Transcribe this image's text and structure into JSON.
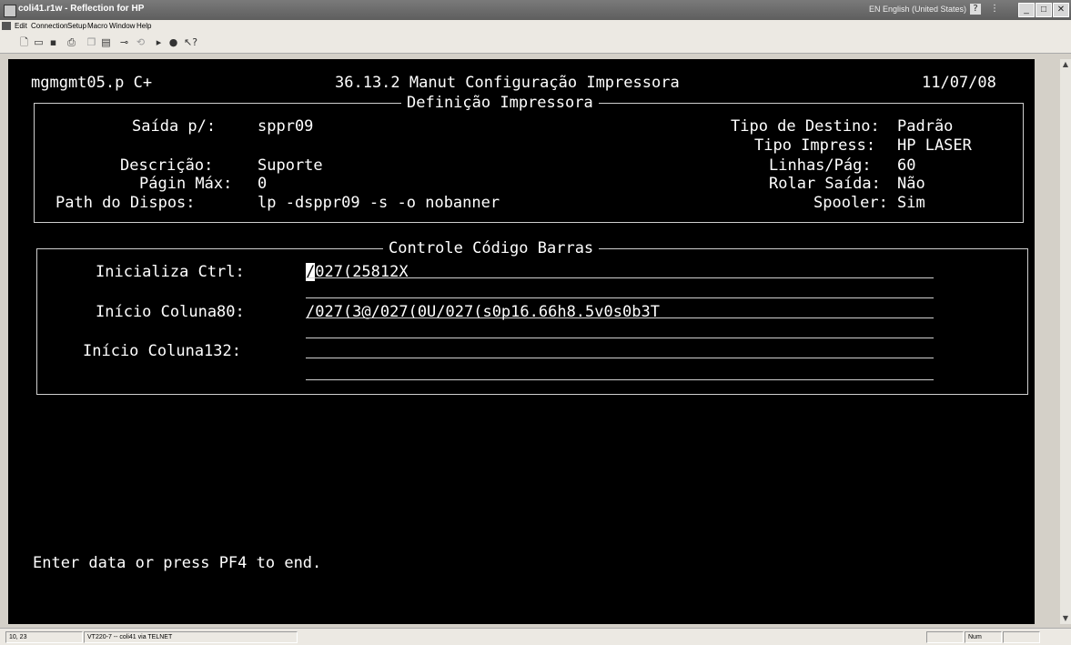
{
  "window": {
    "title": "coli41.r1w - Reflection for HP",
    "language": "EN English (United States)",
    "help_glyph": "?"
  },
  "menu": [
    "Edit",
    "Connection",
    "Setup",
    "Macro",
    "Window",
    "Help"
  ],
  "toolbar": {
    "icons": [
      "new-document-icon",
      "open-folder-icon",
      "save-icon",
      "print-icon",
      "copy-icon",
      "paste-icon",
      "connect-icon",
      "disconnect-icon",
      "play-icon",
      "record-icon",
      "whats-this-help-icon"
    ]
  },
  "terminal": {
    "header": {
      "program": "mgmgmt05.p C+",
      "title": "36.13.2 Manut Configuração Impressora",
      "date": "11/07/08"
    },
    "printer_box": {
      "title": "Definição Impressora",
      "fields": {
        "saida_label": "Saída p/:",
        "saida_value": "sppr09",
        "descricao_label": "Descrição:",
        "descricao_value": "Suporte",
        "pagin_label": "Págin Máx:",
        "pagin_value": "0",
        "path_label": "Path do Dispos:",
        "path_value": "lp -dsppr09 -s -o nobanner",
        "tipo_destino_label": "Tipo de Destino:",
        "tipo_destino_value": "Padrão",
        "tipo_impress_label": "Tipo Impress:",
        "tipo_impress_value": "HP LASER",
        "linhas_label": "Linhas/Pág:",
        "linhas_value": "60",
        "rolar_label": "Rolar Saída:",
        "rolar_value": "Não",
        "spooler_label": "Spooler:",
        "spooler_value": "Sim"
      }
    },
    "barcode_box": {
      "title": "Controle Código Barras",
      "inicializa_label": "Inicializa Ctrl:",
      "inicializa_cursor_char": "/",
      "inicializa_value_rest": "027(25812X",
      "coluna80_label": "Início Coluna80:",
      "coluna80_value": "/027(3@/027(0U/027(s0p16.66h8.5v0s0b3T",
      "coluna132_label": "Início Coluna132:",
      "coluna132_value": ""
    },
    "message": "Enter data or press PF4 to end."
  },
  "statusbar": {
    "position": "10, 23",
    "session": "VT220-7 -- coli41 via TELNET",
    "num": "Num"
  }
}
